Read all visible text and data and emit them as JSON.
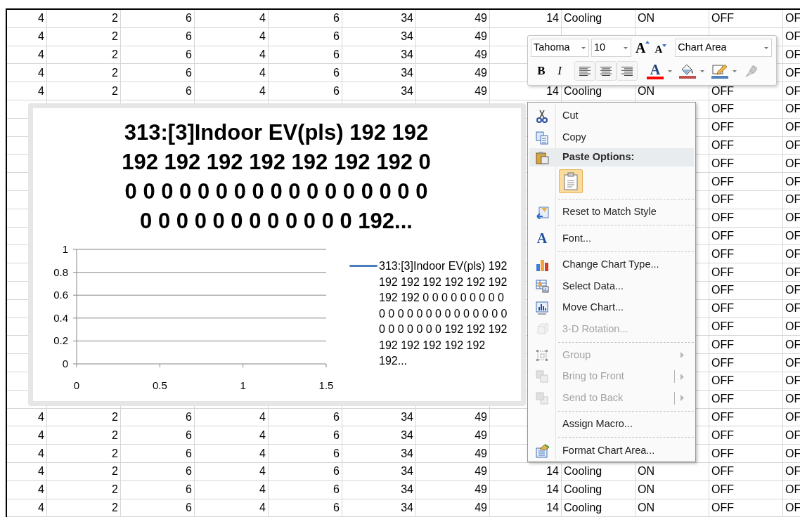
{
  "sheet": {
    "rows": [
      {
        "cells": [
          "4",
          "2",
          "6",
          "4",
          "6",
          "34",
          "49",
          "14",
          "Cooling",
          "ON",
          "OFF",
          "OF"
        ]
      },
      {
        "cells": [
          "4",
          "2",
          "6",
          "4",
          "6",
          "34",
          "49",
          null,
          null,
          null,
          null,
          "OF"
        ]
      },
      {
        "cells": [
          "4",
          "2",
          "6",
          "4",
          "6",
          "34",
          "49",
          null,
          null,
          null,
          null,
          "OF"
        ]
      },
      {
        "cells": [
          "4",
          "2",
          "6",
          "4",
          "6",
          "34",
          "49",
          null,
          null,
          null,
          null,
          "OF"
        ]
      },
      {
        "cells": [
          "4",
          "2",
          "6",
          "4",
          "6",
          "34",
          "49",
          "14",
          "Cooling",
          "ON",
          "OFF",
          "OF"
        ]
      },
      {
        "cells": [
          null,
          null,
          null,
          null,
          null,
          null,
          null,
          null,
          null,
          null,
          "OFF",
          "OF"
        ]
      },
      {
        "cells": [
          null,
          null,
          null,
          null,
          null,
          null,
          null,
          null,
          null,
          null,
          "OFF",
          "OF"
        ]
      },
      {
        "cells": [
          null,
          null,
          null,
          null,
          null,
          null,
          null,
          null,
          null,
          null,
          "OFF",
          "OF"
        ]
      },
      {
        "cells": [
          null,
          null,
          null,
          null,
          null,
          null,
          null,
          null,
          null,
          null,
          "OFF",
          "OF"
        ]
      },
      {
        "cells": [
          null,
          null,
          null,
          null,
          null,
          null,
          null,
          null,
          null,
          null,
          "OFF",
          "OF"
        ]
      },
      {
        "cells": [
          null,
          null,
          null,
          null,
          null,
          null,
          null,
          null,
          null,
          null,
          "OFF",
          "OF"
        ]
      },
      {
        "cells": [
          null,
          null,
          null,
          null,
          null,
          null,
          null,
          null,
          null,
          null,
          "OFF",
          "OF"
        ]
      },
      {
        "cells": [
          null,
          null,
          null,
          null,
          null,
          null,
          null,
          null,
          null,
          null,
          "OFF",
          "OF"
        ]
      },
      {
        "cells": [
          null,
          null,
          null,
          null,
          null,
          null,
          null,
          null,
          null,
          null,
          "OFF",
          "OF"
        ]
      },
      {
        "cells": [
          null,
          null,
          null,
          null,
          null,
          null,
          null,
          null,
          null,
          null,
          "OFF",
          "OF"
        ]
      },
      {
        "cells": [
          null,
          null,
          null,
          null,
          null,
          null,
          null,
          null,
          null,
          null,
          "OFF",
          "OF"
        ]
      },
      {
        "cells": [
          null,
          null,
          null,
          null,
          null,
          null,
          null,
          null,
          null,
          null,
          "OFF",
          "OF"
        ]
      },
      {
        "cells": [
          null,
          null,
          null,
          null,
          null,
          null,
          null,
          null,
          null,
          null,
          "OFF",
          "OF"
        ]
      },
      {
        "cells": [
          null,
          null,
          null,
          null,
          null,
          null,
          null,
          null,
          null,
          null,
          "OFF",
          "OF"
        ]
      },
      {
        "cells": [
          null,
          null,
          null,
          null,
          null,
          null,
          null,
          null,
          null,
          null,
          "OFF",
          "OF"
        ]
      },
      {
        "cells": [
          null,
          null,
          null,
          null,
          null,
          null,
          null,
          null,
          null,
          null,
          "OFF",
          "OF"
        ]
      },
      {
        "cells": [
          null,
          null,
          null,
          null,
          null,
          null,
          null,
          null,
          null,
          null,
          "OFF",
          "OF"
        ]
      },
      {
        "cells": [
          "4",
          "2",
          "6",
          "4",
          "6",
          "34",
          "49",
          null,
          null,
          null,
          "OFF",
          "OF"
        ]
      },
      {
        "cells": [
          "4",
          "2",
          "6",
          "4",
          "6",
          "34",
          "49",
          null,
          null,
          null,
          "OFF",
          "OF"
        ]
      },
      {
        "cells": [
          "4",
          "2",
          "6",
          "4",
          "6",
          "34",
          "49",
          null,
          null,
          null,
          "OFF",
          "OF"
        ]
      },
      {
        "cells": [
          "4",
          "2",
          "6",
          "4",
          "6",
          "34",
          "49",
          "14",
          "Cooling",
          "ON",
          "OFF",
          "OF"
        ]
      },
      {
        "cells": [
          "4",
          "2",
          "6",
          "4",
          "6",
          "34",
          "49",
          "14",
          "Cooling",
          "ON",
          "OFF",
          "OF"
        ]
      },
      {
        "cells": [
          "4",
          "2",
          "6",
          "4",
          "6",
          "34",
          "49",
          "14",
          "Cooling",
          "ON",
          "OFF",
          "OF"
        ]
      }
    ]
  },
  "chart": {
    "chart_data": {
      "type": "line",
      "title": "313:[3]Indoor EV(pls) 192 192 192 192 192 192 192 192 192 0 0 0 0 0 0 0 0 0 0 0 0 0 0 0 0 0 0 0 0 0 0 0 0 0 0 0 0 0 0 192...",
      "series": [
        {
          "name": "313:[3]Indoor EV(pls) 192 192 192 192 192 192 192 192 192 0 0 0 0 0 0 0 0 0 0 0 0 0 0 0 0 0 0 0 0 0 0 0 0 0 0 0 0 0 0 192 192 192 192 192 192 192 192 192...",
          "color": "#4a7ebb",
          "values": [
            null,
            null,
            null,
            null
          ]
        }
      ],
      "categories": [
        "0",
        "0.5",
        "1",
        "1.5"
      ],
      "ylim": [
        0,
        1
      ],
      "yticks": [
        0,
        0.2,
        0.4,
        0.6,
        0.8,
        1
      ],
      "grid": true
    }
  },
  "mini_toolbar": {
    "font": "Tahoma",
    "size": "10",
    "grow_font": "A",
    "shrink_font": "A",
    "chart_element": "Chart Area",
    "bold": "B",
    "italic": "I",
    "color_buttons": [
      {
        "kind": "font_color",
        "text": "A",
        "color": "#ff0000"
      },
      {
        "kind": "fill_color",
        "color": "#c0504d"
      },
      {
        "kind": "outline_color",
        "color": "#4f81bd"
      }
    ]
  },
  "context_menu": {
    "items": [
      {
        "kind": "item",
        "label": "Cut",
        "disabled": false
      },
      {
        "kind": "item",
        "label": "Copy",
        "disabled": false
      },
      {
        "kind": "header",
        "label": "Paste Options:"
      },
      {
        "kind": "paste_option",
        "selected": true
      },
      {
        "kind": "separator"
      },
      {
        "kind": "item",
        "label": "Reset to Match Style",
        "disabled": false
      },
      {
        "kind": "separator"
      },
      {
        "kind": "item",
        "label": "Font...",
        "icon_text": "A",
        "disabled": false
      },
      {
        "kind": "separator"
      },
      {
        "kind": "item",
        "label": "Change Chart Type...",
        "disabled": false
      },
      {
        "kind": "item",
        "label": "Select Data...",
        "disabled": false
      },
      {
        "kind": "item",
        "label": "Move Chart...",
        "disabled": false
      },
      {
        "kind": "item",
        "label": "3-D Rotation...",
        "disabled": true
      },
      {
        "kind": "separator"
      },
      {
        "kind": "item",
        "label": "Group",
        "disabled": true,
        "submenu": true,
        "split": false
      },
      {
        "kind": "item",
        "label": "Bring to Front",
        "disabled": true,
        "submenu": true,
        "split": true
      },
      {
        "kind": "item",
        "label": "Send to Back",
        "disabled": true,
        "submenu": true,
        "split": true
      },
      {
        "kind": "separator"
      },
      {
        "kind": "item",
        "label": "Assign Macro...",
        "disabled": false
      },
      {
        "kind": "separator"
      },
      {
        "kind": "item",
        "label": "Format Chart Area...",
        "disabled": false
      }
    ]
  }
}
